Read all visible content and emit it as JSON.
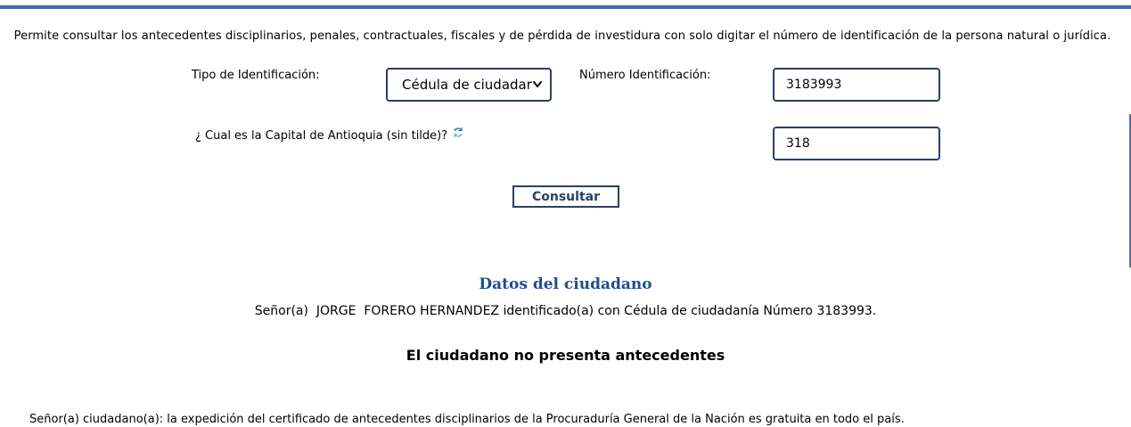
{
  "colors": {
    "top_bar": "#3f6bb0",
    "title_blue": "#1f4e8c",
    "input_border": "#2b3f66"
  },
  "intro_text": "Permite consultar los antecedentes disciplinarios, penales, contractuales, fiscales y de pérdida de investidura con solo digitar el número de identificación de la persona natural o jurídica.",
  "form": {
    "tipo_label": "Tipo de Identificación:",
    "tipo_selected": "Cédula de ciudadar",
    "numero_label": "Número Identificación:",
    "numero_value": "3183993",
    "question_label": "¿ Cual es la Capital de Antioquia (sin tilde)?",
    "answer_value": "318",
    "refresh_icon": "refresh-icon",
    "submit_label": "Consultar"
  },
  "result": {
    "title": "Datos del ciudadano",
    "citizen_line": "Señor(a)  JORGE  FORERO HERNANDEZ identificado(a) con Cédula de ciudadanía Número 3183993.",
    "status": "El ciudadano no presenta antecedentes"
  },
  "footer_note": "Señor(a) ciudadano(a): la expedición del certificado de antecedentes disciplinarios de la Procuraduría General de la Nación es gratuita en todo el país."
}
